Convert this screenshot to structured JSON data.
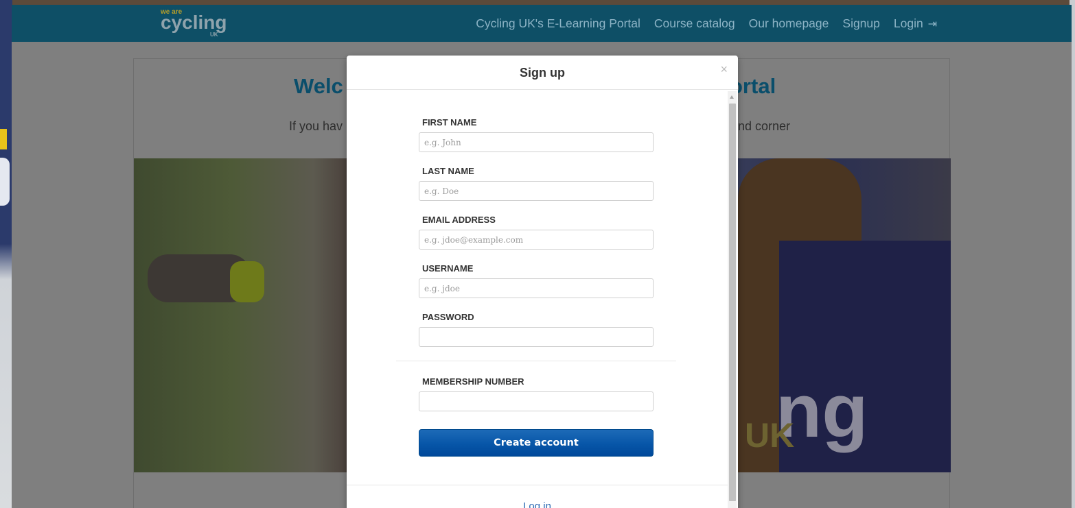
{
  "header": {
    "logo": {
      "small": "we are",
      "main": "cycling",
      "sub": "UK"
    },
    "nav": [
      {
        "label": "Cycling UK's E-Learning Portal"
      },
      {
        "label": "Course catalog"
      },
      {
        "label": "Our homepage"
      },
      {
        "label": "Signup"
      },
      {
        "label": "Login"
      }
    ],
    "login_icon": "login-arrow-icon"
  },
  "background": {
    "welcome_left": "Welc",
    "welcome_right": "ortal",
    "intro_left": "If you hav",
    "intro_right": "nd corner",
    "hero_letters": "ng",
    "hero_uk": "UK"
  },
  "modal": {
    "title": "Sign up",
    "close_label": "×",
    "fields": [
      {
        "label": "FIRST NAME",
        "placeholder": "e.g. John",
        "value": ""
      },
      {
        "label": "LAST NAME",
        "placeholder": "e.g. Doe",
        "value": ""
      },
      {
        "label": "EMAIL ADDRESS",
        "placeholder": "e.g. jdoe@example.com",
        "value": ""
      },
      {
        "label": "USERNAME",
        "placeholder": "e.g. jdoe",
        "value": ""
      },
      {
        "label": "PASSWORD",
        "placeholder": "",
        "value": ""
      }
    ],
    "membership": {
      "label": "MEMBERSHIP NUMBER",
      "placeholder": "",
      "value": ""
    },
    "submit_label": "Create account",
    "footer_link": "Log in"
  },
  "colors": {
    "topbar": "#0e4f66",
    "primary_button": "#0756a8",
    "link": "#2b69b3"
  }
}
